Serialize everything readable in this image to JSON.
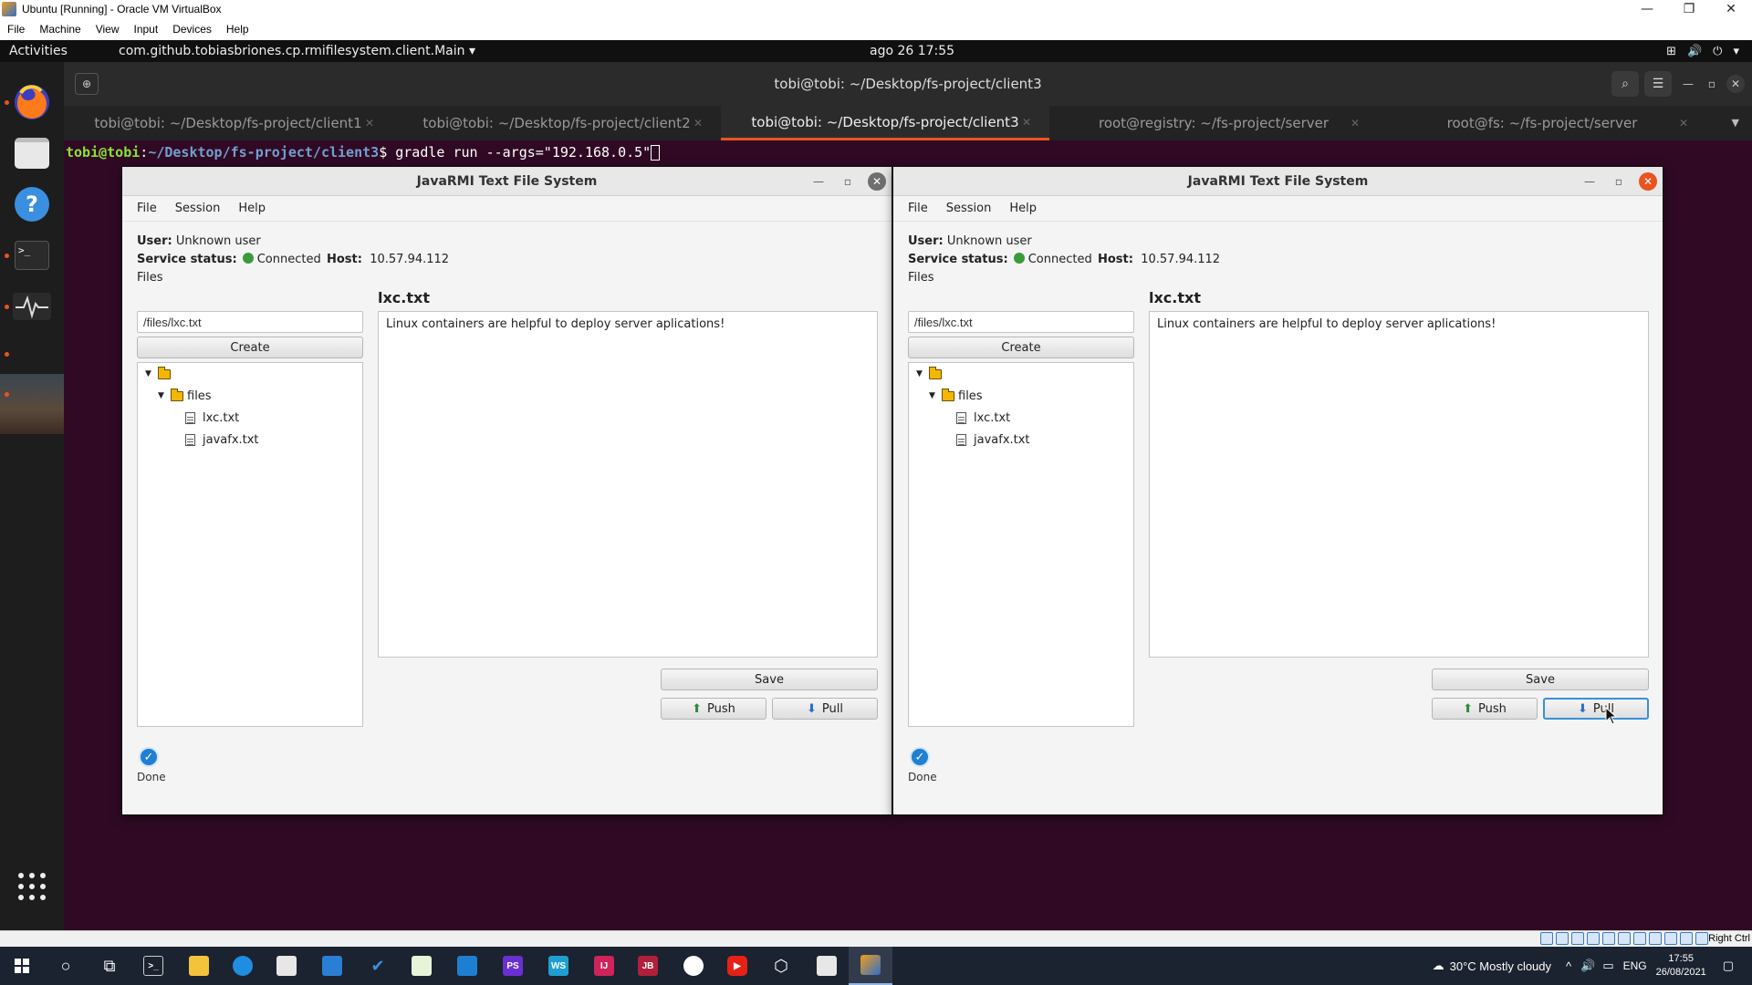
{
  "host": {
    "title": "Ubuntu [Running] - Oracle VM VirtualBox",
    "menu": [
      "File",
      "Machine",
      "View",
      "Input",
      "Devices",
      "Help"
    ],
    "status_right": "Right Ctrl"
  },
  "gnome": {
    "activities": "Activities",
    "app_name": "com.github.tobiasbriones.cp.rmifilesystem.client.Main ▾",
    "clock": "ago 26  17:55",
    "tray": [
      "⊞",
      "🔊",
      "⏻",
      "▾"
    ]
  },
  "terminal": {
    "title": "tobi@tobi: ~/Desktop/fs-project/client3",
    "tabs": [
      {
        "label": "tobi@tobi: ~/Desktop/fs-project/client1",
        "active": false
      },
      {
        "label": "tobi@tobi: ~/Desktop/fs-project/client2",
        "active": false
      },
      {
        "label": "tobi@tobi: ~/Desktop/fs-project/client3",
        "active": true
      },
      {
        "label": "root@registry: ~/fs-project/server",
        "active": false
      },
      {
        "label": "root@fs: ~/fs-project/server",
        "active": false
      }
    ],
    "prompt_user": "tobi@tobi",
    "prompt_sep": ":",
    "prompt_path": "~/Desktop/fs-project/client3",
    "prompt_symbol": "$ ",
    "command": "gradle run --args=\"192.168.0.5\""
  },
  "fx_windows": [
    {
      "title": "JavaRMI Text File System",
      "menu": [
        "File",
        "Session",
        "Help"
      ],
      "user_label": "User:",
      "user_value": "Unknown user",
      "status_label": "Service status:",
      "status_value": "Connected",
      "host_label": "Host:",
      "host_value": "10.57.94.112",
      "files_label": "Files",
      "path_value": "/files/lxc.txt",
      "create_label": "Create",
      "tree": {
        "root_folder": "",
        "folder": "files",
        "files": [
          "lxc.txt",
          "javafx.txt"
        ]
      },
      "file_title": "lxc.txt",
      "content": "Linux containers are helpful to deploy server aplications!",
      "save_label": "Save",
      "push_label": "Push",
      "pull_label": "Pull",
      "done_label": "Done"
    },
    {
      "title": "JavaRMI Text File System",
      "menu": [
        "File",
        "Session",
        "Help"
      ],
      "user_label": "User:",
      "user_value": "Unknown user",
      "status_label": "Service status:",
      "status_value": "Connected",
      "host_label": "Host:",
      "host_value": "10.57.94.112",
      "files_label": "Files",
      "path_value": "/files/lxc.txt",
      "create_label": "Create",
      "tree": {
        "root_folder": "",
        "folder": "files",
        "files": [
          "lxc.txt",
          "javafx.txt"
        ]
      },
      "file_title": "lxc.txt",
      "content": "Linux containers are helpful to deploy server aplications!",
      "save_label": "Save",
      "push_label": "Push",
      "pull_label": "Pull",
      "done_label": "Done"
    }
  ],
  "taskbar": {
    "weather": "30°C  Mostly cloudy",
    "lang": "ENG",
    "time": "17:55",
    "date": "26/08/2021"
  },
  "colors": {
    "ubuntu_orange": "#e95420",
    "terminal_bg": "#300a24",
    "connected_green": "#3a9b3a",
    "focus_blue": "#3a8fd8"
  }
}
